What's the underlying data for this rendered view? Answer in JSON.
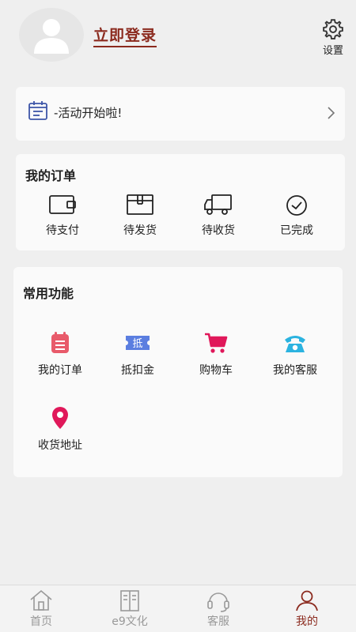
{
  "header": {
    "login_label": "立即登录",
    "settings_label": "设置"
  },
  "promo": {
    "text": "-活动开始啦!"
  },
  "orders": {
    "title": "我的订单",
    "items": [
      {
        "label": "待支付",
        "icon": "wallet-icon"
      },
      {
        "label": "待发货",
        "icon": "package-icon"
      },
      {
        "label": "待收货",
        "icon": "truck-icon"
      },
      {
        "label": "已完成",
        "icon": "check-circle-icon"
      }
    ]
  },
  "functions": {
    "title": "常用功能",
    "items": [
      {
        "label": "我的订单",
        "icon": "order-list-icon",
        "color": "#e85a6a"
      },
      {
        "label": "抵扣金",
        "icon": "coupon-icon",
        "color": "#4a6fd6",
        "glyph": "抵"
      },
      {
        "label": "购物车",
        "icon": "cart-icon",
        "color": "#e0185a"
      },
      {
        "label": "我的客服",
        "icon": "phone-icon",
        "color": "#2bb3e0"
      },
      {
        "label": "收货地址",
        "icon": "location-pin-icon",
        "color": "#e0185a"
      }
    ]
  },
  "tabbar": {
    "tabs": [
      {
        "label": "首页",
        "icon": "home-icon"
      },
      {
        "label": "e9文化",
        "icon": "book-icon"
      },
      {
        "label": "客服",
        "icon": "headset-icon"
      },
      {
        "label": "我的",
        "icon": "user-icon",
        "active": true
      }
    ]
  },
  "colors": {
    "accent": "#8b2a1e",
    "background": "#efefef",
    "card": "#fafafa",
    "inactive_tab": "#999999"
  }
}
